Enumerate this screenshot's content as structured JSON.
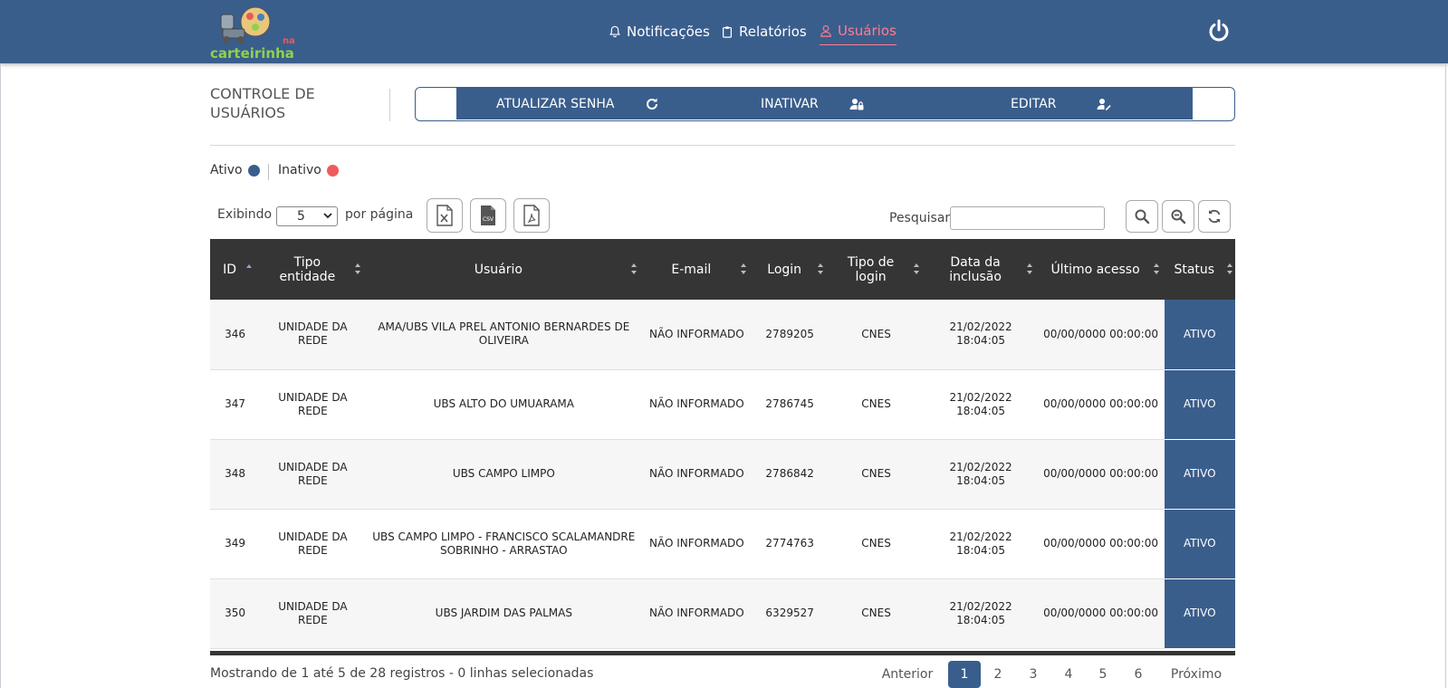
{
  "header": {
    "brand": "carteirinha",
    "brand_prefix": "na",
    "nav": [
      {
        "label": "Notificações",
        "icon": "bell-icon"
      },
      {
        "label": "Relatórios",
        "icon": "clipboard-icon"
      },
      {
        "label": "Usuários",
        "icon": "user-icon",
        "active": true
      }
    ],
    "logout_icon": "power-icon"
  },
  "page": {
    "title": "CONTROLE DE USUÁRIOS",
    "actions": [
      {
        "label": "ATUALIZAR SENHA",
        "icon": "refresh-icon"
      },
      {
        "label": "INATIVAR",
        "icon": "user-lock-icon"
      },
      {
        "label": "EDITAR",
        "icon": "user-edit-icon"
      }
    ]
  },
  "legend": {
    "active_label": "Ativo",
    "inactive_label": "Inativo",
    "active_color": "#3a5e8c",
    "inactive_color": "#f05a5a"
  },
  "controls": {
    "showing_label": "Exibindo",
    "page_size": "5",
    "per_page_label": "por página",
    "export_icons": [
      "excel-file-icon",
      "csv-file-icon",
      "pdf-file-icon"
    ],
    "search_label": "Pesquisar",
    "search_value": "",
    "tool_icons": [
      "search-icon",
      "zoom-out-icon",
      "refresh-icon"
    ]
  },
  "table": {
    "columns": [
      "ID",
      "Tipo entidade",
      "Usuário",
      "E-mail",
      "Login",
      "Tipo de login",
      "Data da inclusão",
      "Último acesso",
      "Status"
    ],
    "sorted_column": "ID",
    "rows": [
      {
        "id": "346",
        "tipo": "UNIDADE DA REDE",
        "usuario": "AMA/UBS VILA PREL ANTONIO BERNARDES DE OLIVEIRA",
        "email": "NÃO INFORMADO",
        "login": "2789205",
        "tipo_login": "CNES",
        "inclusao": "21/02/2022 18:04:05",
        "acesso": "00/00/0000 00:00:00",
        "status": "ATIVO"
      },
      {
        "id": "347",
        "tipo": "UNIDADE DA REDE",
        "usuario": "UBS ALTO DO UMUARAMA",
        "email": "NÃO INFORMADO",
        "login": "2786745",
        "tipo_login": "CNES",
        "inclusao": "21/02/2022 18:04:05",
        "acesso": "00/00/0000 00:00:00",
        "status": "ATIVO"
      },
      {
        "id": "348",
        "tipo": "UNIDADE DA REDE",
        "usuario": "UBS CAMPO LIMPO",
        "email": "NÃO INFORMADO",
        "login": "2786842",
        "tipo_login": "CNES",
        "inclusao": "21/02/2022 18:04:05",
        "acesso": "00/00/0000 00:00:00",
        "status": "ATIVO"
      },
      {
        "id": "349",
        "tipo": "UNIDADE DA REDE",
        "usuario": "UBS CAMPO LIMPO - FRANCISCO SCALAMANDRE SOBRINHO - ARRASTAO",
        "email": "NÃO INFORMADO",
        "login": "2774763",
        "tipo_login": "CNES",
        "inclusao": "21/02/2022 18:04:05",
        "acesso": "00/00/0000 00:00:00",
        "status": "ATIVO"
      },
      {
        "id": "350",
        "tipo": "UNIDADE DA REDE",
        "usuario": "UBS JARDIM DAS PALMAS",
        "email": "NÃO INFORMADO",
        "login": "6329527",
        "tipo_login": "CNES",
        "inclusao": "21/02/2022 18:04:05",
        "acesso": "00/00/0000 00:00:00",
        "status": "ATIVO"
      }
    ]
  },
  "footer": {
    "info": "Mostrando de 1 até 5 de 28 registros - 0 linhas selecionadas",
    "prev": "Anterior",
    "next": "Próximo",
    "pages": [
      "1",
      "2",
      "3",
      "4",
      "5",
      "6"
    ],
    "current_page": "1"
  }
}
